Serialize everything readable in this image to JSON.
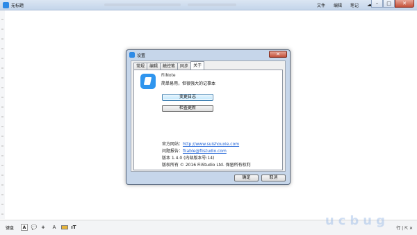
{
  "window": {
    "title": "无标题",
    "menu": [
      "文件",
      "编辑",
      "笔记"
    ],
    "cloud_icon": "cloud-icon",
    "controls": [
      "minimize-icon",
      "maximize-icon",
      "close-icon"
    ]
  },
  "toolbar": {
    "keyboard_label": "键盘",
    "text_glyph": "A",
    "comment_glyph": "💬",
    "plus_glyph": "+",
    "color_glyph": "A",
    "format_glyph": "ıT",
    "right_label": "行 | ⇱ ✕"
  },
  "watermark": "ucbug",
  "dialog": {
    "title": "设置",
    "close_glyph": "✕",
    "tabs": [
      "常规",
      "编辑",
      "触控笔",
      "同步",
      "关于"
    ],
    "active_tab": 4,
    "about": {
      "app_name": "FiiNote",
      "tagline": "简单易用，但很强大的记事本",
      "changelog_button": "变更日志",
      "update_button": "检查更新",
      "site_label": "官方网站：",
      "site_link": "http://www.suishouxie.com",
      "feedback_label": "问题报告：",
      "feedback_link": "fiiable@fiistudio.com",
      "version": "版本 1.4.0 (内部版本号:14)",
      "copyright": "版权所有 © 2016 FiiStudio Ltd. 保留所有权利"
    },
    "ok_button": "确定",
    "cancel_button": "取消"
  }
}
